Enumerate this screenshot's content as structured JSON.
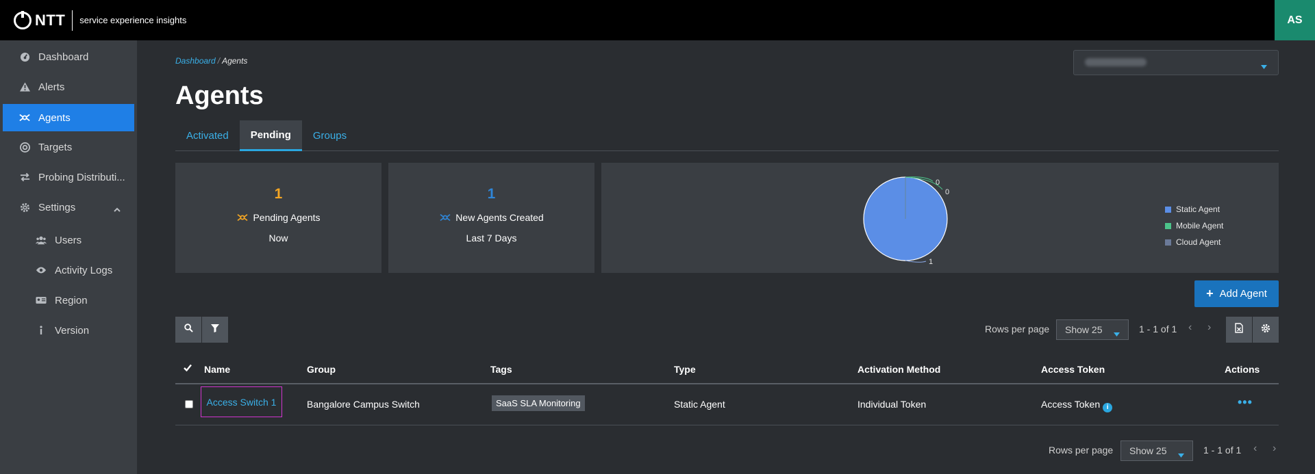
{
  "brand": {
    "logo": "NTT",
    "subtitle": "service experience insights"
  },
  "user": {
    "initials": "AS"
  },
  "sidebar": {
    "items": [
      {
        "label": "Dashboard",
        "icon": "dashboard-icon"
      },
      {
        "label": "Alerts",
        "icon": "warning-icon"
      },
      {
        "label": "Agents",
        "icon": "agents-icon",
        "active": true
      },
      {
        "label": "Targets",
        "icon": "target-icon"
      },
      {
        "label": "Probing Distributi...",
        "icon": "arrows-icon"
      },
      {
        "label": "Settings",
        "icon": "gear-icon"
      },
      {
        "label": "Users",
        "icon": "users-icon"
      },
      {
        "label": "Activity Logs",
        "icon": "eye-icon"
      },
      {
        "label": "Region",
        "icon": "region-icon"
      },
      {
        "label": "Version",
        "icon": "info-icon"
      }
    ]
  },
  "breadcrumb": {
    "root": "Dashboard",
    "current": "Agents"
  },
  "page": {
    "title": "Agents"
  },
  "tabs": [
    {
      "label": "Activated"
    },
    {
      "label": "Pending",
      "active": true
    },
    {
      "label": "Groups"
    }
  ],
  "cards": [
    {
      "value": "1",
      "label": "Pending Agents",
      "sub": "Now",
      "color": "#f5a623"
    },
    {
      "value": "1",
      "label": "New Agents Created",
      "sub": "Last 7 Days",
      "color": "#2f86d8"
    }
  ],
  "chart_data": {
    "type": "pie",
    "categories": [
      "Static Agent",
      "Mobile Agent",
      "Cloud Agent"
    ],
    "values": [
      1,
      0,
      0
    ],
    "colors": [
      "#5b8ee6",
      "#4cc38a",
      "#6b7a99"
    ],
    "data_labels": [
      "1",
      "0",
      "0"
    ],
    "legend": "right"
  },
  "actions": {
    "add_agent": "Add Agent"
  },
  "pagination": {
    "rows_label": "Rows per page",
    "rows_value": "Show 25",
    "range": "1 - 1 of 1"
  },
  "table": {
    "columns": [
      "Name",
      "Group",
      "Tags",
      "Type",
      "Activation Method",
      "Access Token",
      "Actions"
    ],
    "rows": [
      {
        "name": "Access Switch 1",
        "group": "Bangalore Campus Switch",
        "tag": "SaaS SLA Monitoring",
        "type": "Static Agent",
        "activation": "Individual Token",
        "token": "Access Token"
      }
    ]
  },
  "colors": {
    "accent": "#1f7fe6",
    "link": "#3ab0e8",
    "brand_green": "#1a8a6e"
  }
}
